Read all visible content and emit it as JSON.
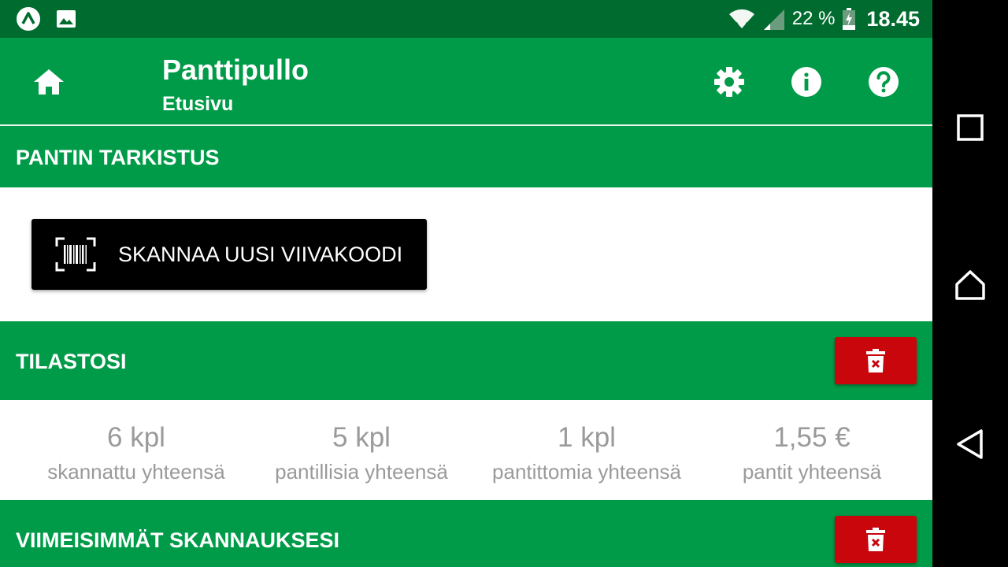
{
  "status_bar": {
    "left_icons": [
      "app-notification-icon",
      "image-notification-icon"
    ],
    "right_icons": [
      "wifi-icon",
      "signal-icon",
      "battery-icon"
    ],
    "battery_text": "22 %",
    "time": "18.45"
  },
  "app_bar": {
    "title": "Panttipullo",
    "subtitle": "Etusivu",
    "actions": [
      "home-icon",
      "settings-icon",
      "info-icon",
      "help-icon"
    ]
  },
  "sections": {
    "check": {
      "title": "PANTIN TARKISTUS",
      "scan_button_label": "SKANNAA UUSI VIIVAKOODI"
    },
    "stats": {
      "title": "TILASTOSI",
      "items": [
        {
          "value": "6 kpl",
          "label": "skannattu yhteensä"
        },
        {
          "value": "5 kpl",
          "label": "pantillisia yhteensä"
        },
        {
          "value": "1 kpl",
          "label": "pantittomia yhteensä"
        },
        {
          "value": "1,55 €",
          "label": "pantit yhteensä"
        }
      ]
    },
    "recent": {
      "title": "VIIMEISIMMÄT SKANNAUKSESI"
    }
  },
  "nav_bar": {
    "buttons": [
      "recents-icon",
      "home-nav-icon",
      "back-icon"
    ]
  },
  "colors": {
    "primary": "#009B48",
    "status_bar": "#006B2E",
    "danger": "#C8060C",
    "button": "#000000"
  }
}
